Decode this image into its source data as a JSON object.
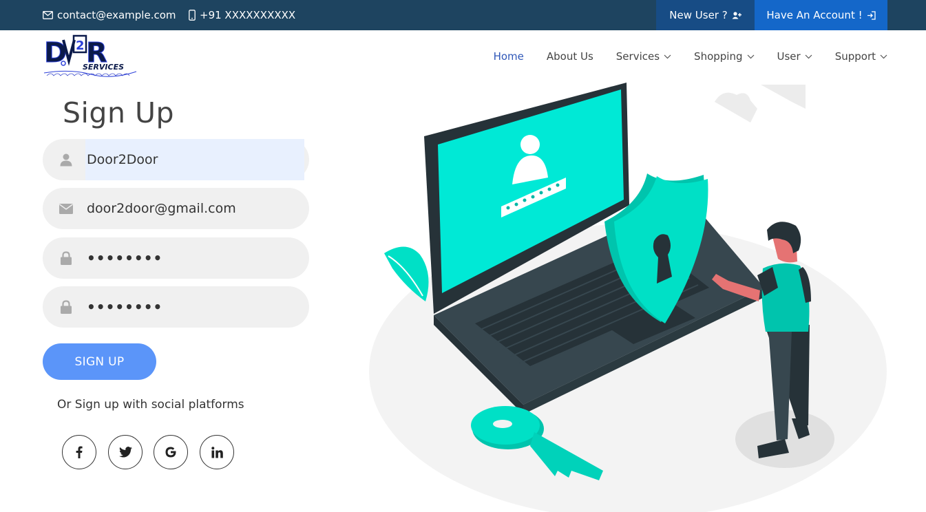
{
  "topbar": {
    "email": "contact@example.com",
    "phone": "+91 XXXXXXXXXX",
    "new_user": "New User ?",
    "have_account": "Have An Account !"
  },
  "nav": {
    "items": [
      {
        "label": "Home",
        "active": true,
        "has_dropdown": false
      },
      {
        "label": "About Us",
        "active": false,
        "has_dropdown": false
      },
      {
        "label": "Services",
        "active": false,
        "has_dropdown": true
      },
      {
        "label": "Shopping",
        "active": false,
        "has_dropdown": true
      },
      {
        "label": "User",
        "active": false,
        "has_dropdown": true
      },
      {
        "label": "Support",
        "active": false,
        "has_dropdown": true
      }
    ]
  },
  "form": {
    "title": "Sign Up",
    "username_value": "Door2Door",
    "email_value": "door2door@gmail.com",
    "password_value": "••••••••",
    "confirm_value": "••••••••",
    "submit_label": "SIGN UP",
    "social_text": "Or Sign up with social platforms"
  },
  "icons": {
    "username": "user-icon",
    "email": "envelope-icon",
    "password": "lock-icon",
    "social": [
      "facebook-icon",
      "twitter-icon",
      "google-icon",
      "linkedin-icon"
    ]
  },
  "colors": {
    "topbar": "#1e4460",
    "new_user_bg": "#174c85",
    "have_account_bg": "#1467c9",
    "accent_teal": "#00e0c6",
    "signup_button": "#5b95f9",
    "nav_active": "#2f57b8"
  }
}
